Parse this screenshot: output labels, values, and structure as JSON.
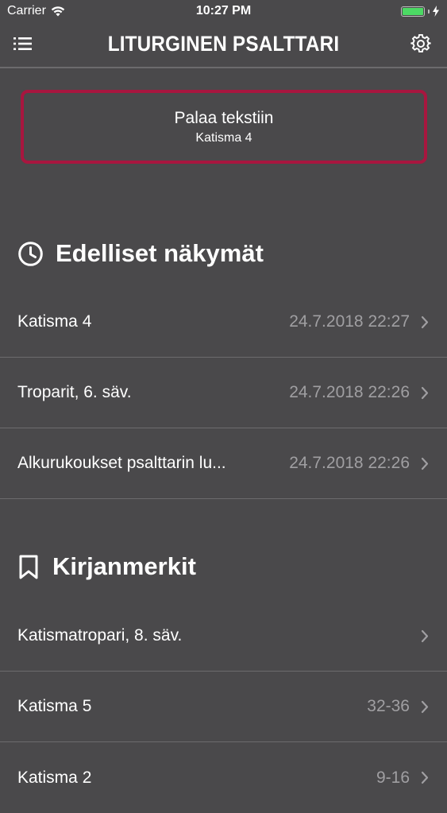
{
  "status_bar": {
    "carrier": "Carrier",
    "time": "10:27 PM",
    "battery_color": "#4cd964"
  },
  "nav": {
    "title": "LITURGINEN PSALTTARI",
    "menu_icon": "list-icon",
    "settings_icon": "gear-icon"
  },
  "return_button": {
    "title": "Palaa tekstiin",
    "subtitle": "Katisma 4",
    "border_color": "#a8163f"
  },
  "recent": {
    "heading": "Edelliset näkymät",
    "icon": "clock-icon",
    "items": [
      {
        "label": "Katisma 4",
        "value": "24.7.2018 22:27"
      },
      {
        "label": "Troparit, 6. säv.",
        "value": "24.7.2018 22:26"
      },
      {
        "label": "Alkurukoukset psalttarin lu...",
        "value": "24.7.2018 22:26"
      }
    ]
  },
  "bookmarks": {
    "heading": "Kirjanmerkit",
    "icon": "bookmark-icon",
    "items": [
      {
        "label": "Katismatropari, 8. säv.",
        "value": ""
      },
      {
        "label": "Katisma 5",
        "value": "32-36"
      },
      {
        "label": "Katisma 2",
        "value": "9-16"
      }
    ]
  }
}
